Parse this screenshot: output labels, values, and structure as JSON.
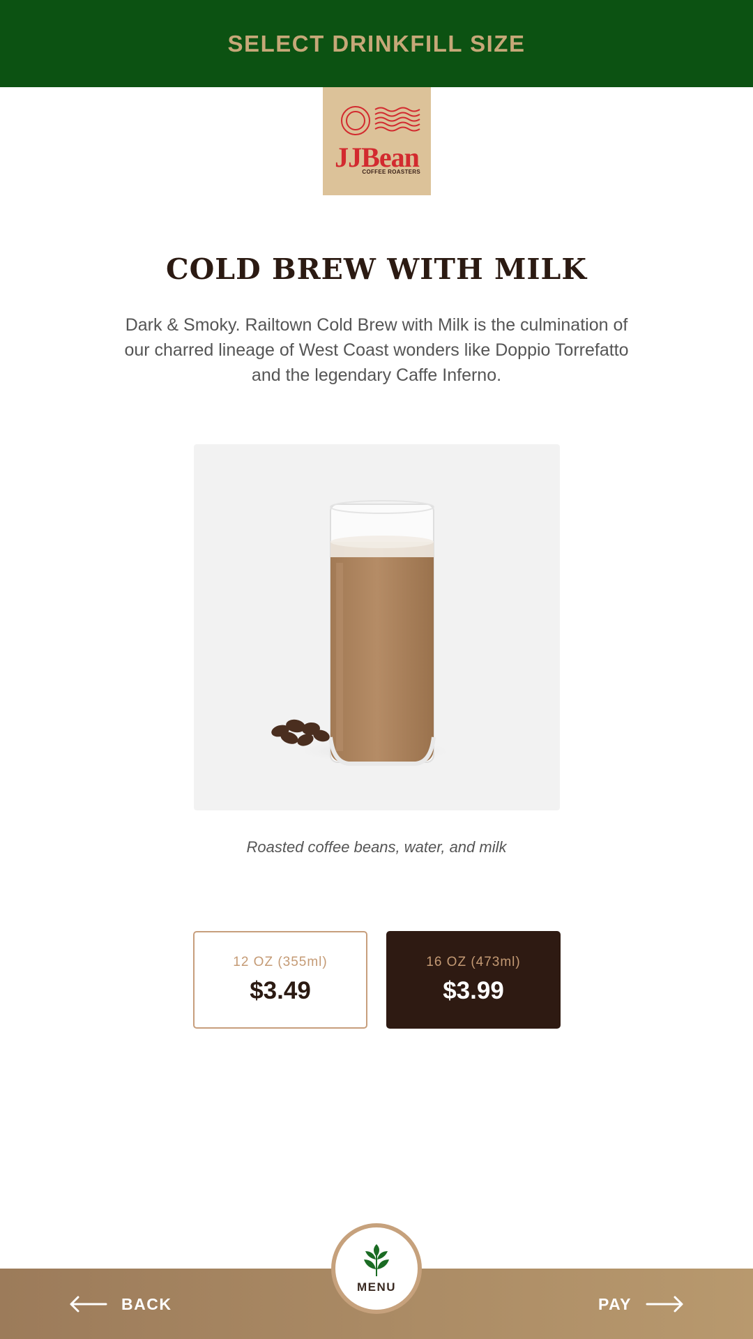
{
  "header": {
    "title": "SELECT DRINKFILL SIZE"
  },
  "brand": {
    "name": "JJBean",
    "tagline": "COFFEE ROASTERS"
  },
  "product": {
    "name": "COLD BREW WITH MILK",
    "description": "Dark & Smoky. Railtown Cold Brew with Milk is the culmination of our charred lineage of West Coast wonders like Doppio Torrefatto and the legendary Caffe Inferno.",
    "ingredients": "Roasted coffee beans, water, and milk"
  },
  "sizes": [
    {
      "label": "12 OZ (355ml)",
      "price": "$3.49",
      "selected": false
    },
    {
      "label": "16 OZ (473ml)",
      "price": "$3.99",
      "selected": true
    }
  ],
  "footer": {
    "back_label": "BACK",
    "menu_label": "MENU",
    "pay_label": "PAY"
  },
  "colors": {
    "header_bg": "#0c5212",
    "header_text": "#c6a878",
    "accent_brown": "#2e1a12",
    "footer_tan": "#b08f66"
  },
  "icons": {
    "back": "arrow-left-icon",
    "pay": "arrow-right-icon",
    "menu": "leaf-icon",
    "logo": "postmark-icon"
  }
}
